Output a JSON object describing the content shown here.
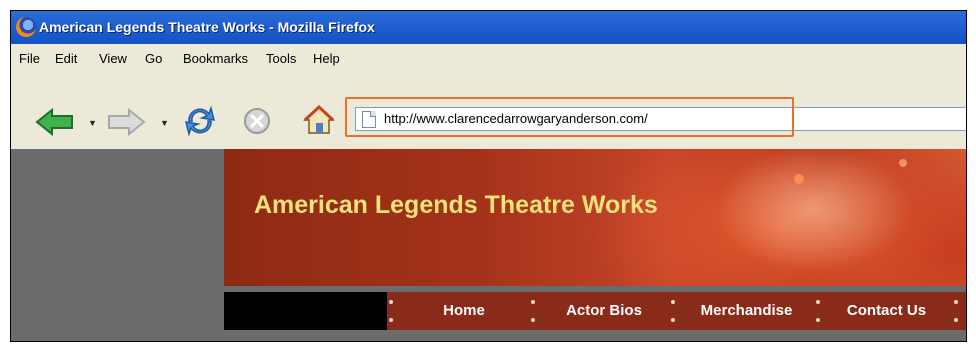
{
  "window": {
    "title": "American Legends Theatre Works - Mozilla Firefox"
  },
  "menu": {
    "items": [
      "File",
      "Edit",
      "View",
      "Go",
      "Bookmarks",
      "Tools",
      "Help"
    ]
  },
  "toolbar": {
    "icons": [
      "back-icon",
      "forward-icon",
      "reload-icon",
      "stop-icon",
      "home-icon",
      "page-icon"
    ],
    "url": "http://www.clarencedarrowgaryanderson.com/"
  },
  "site": {
    "title": "American Legends Theatre Works",
    "nav": [
      "Home",
      "Actor Bios",
      "Merchandise",
      "Contact Us"
    ]
  },
  "colors": {
    "title_text": "#f4e27a",
    "nav_bg": "#8a2a19",
    "highlight": "#e8702a"
  }
}
